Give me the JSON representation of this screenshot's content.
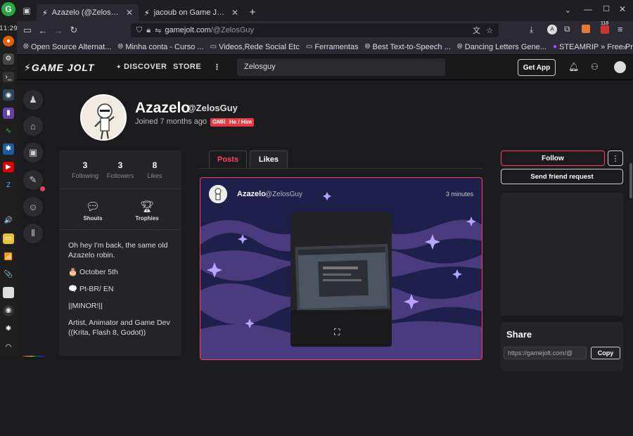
{
  "os": {
    "clock": "11:29",
    "brand_color": "#27a844"
  },
  "browser": {
    "tabs": [
      {
        "title": "Azazelo (@ZelosGuy) - Ga",
        "active": true
      },
      {
        "title": "jacoub on Game Jolt: \"ME",
        "active": false
      }
    ],
    "new_tab": "+",
    "url": {
      "host": "gamejolt.com",
      "path": "/@ZelosGuy"
    },
    "badges": {
      "ext_count": "118"
    },
    "bookmarks": [
      {
        "icon": "globe-icon",
        "label": "Open Source Alternat..."
      },
      {
        "icon": "globe-icon",
        "label": "Minha conta - Curso ..."
      },
      {
        "icon": "folder-icon",
        "label": "Videos,Rede Social Etc"
      },
      {
        "icon": "folder-icon",
        "label": "Ferramentas"
      },
      {
        "icon": "globe-icon",
        "label": "Best Text-to-Speech ..."
      },
      {
        "icon": "globe-icon",
        "label": "Dancing Letters Gene..."
      },
      {
        "icon": "steamrip-icon",
        "label": "STEAMRIP » Free Pre-..."
      }
    ],
    "overflow": "»"
  },
  "gamejolt": {
    "logo": "GAME JOLT",
    "nav": {
      "discover": "DISCOVER",
      "store": "STORE",
      "more": "⋮"
    },
    "search_value": "Zelosguy",
    "get_app": "Get App",
    "accent": "#ff3f5f"
  },
  "profile": {
    "name": "Azazelo",
    "username": "@ZelosGuy",
    "joined": "Joined 7 months ago",
    "dot": "•",
    "badges": [
      "GMR",
      "He / Him"
    ],
    "stats": [
      {
        "value": "3",
        "label": "Following"
      },
      {
        "value": "3",
        "label": "Followers"
      },
      {
        "value": "8",
        "label": "Likes"
      }
    ],
    "trophies": [
      {
        "icon": "speech-bubble-icon",
        "label": "Shouts"
      },
      {
        "icon": "trophy-icon",
        "label": "Trophies"
      }
    ],
    "bio": [
      "Oh hey I'm back, the same old Azazelo robin.",
      "🎂 October 5th",
      "🗨️ Pt-BR/ EN",
      "||MINOR!||",
      "Artist, Animator and Game Dev ((Krita, Flash 8, Godot))"
    ]
  },
  "tabs": {
    "posts": "Posts",
    "likes": "Likes"
  },
  "post": {
    "name": "Azazelo",
    "username": "@ZelosGuy",
    "time": "3 minutes"
  },
  "actions": {
    "follow": "Follow",
    "more": "⋮",
    "friend": "Send friend request"
  },
  "share": {
    "title": "Share",
    "url": "https://gamejolt.com/@",
    "copy": "Copy"
  }
}
